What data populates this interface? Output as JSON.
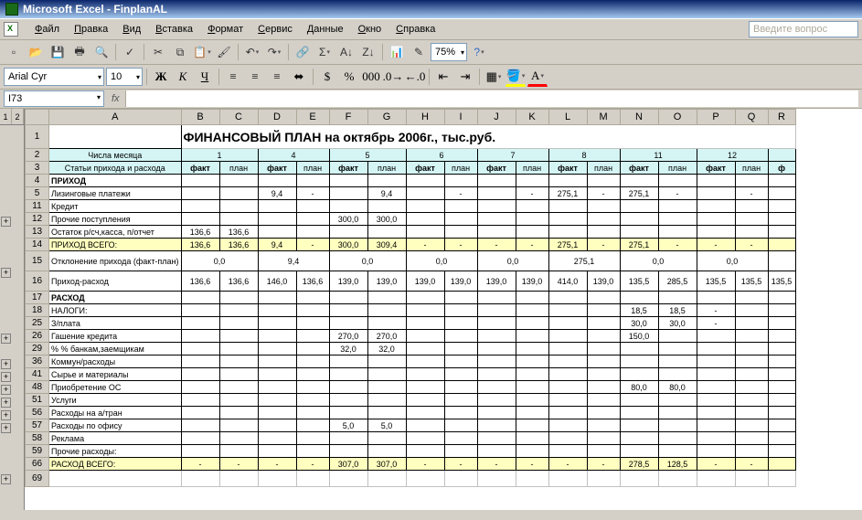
{
  "app_title": "Microsoft Excel - FinplanAL",
  "menus": [
    "Файл",
    "Правка",
    "Вид",
    "Вставка",
    "Формат",
    "Сервис",
    "Данные",
    "Окно",
    "Справка"
  ],
  "help_placeholder": "Введите вопрос",
  "zoom": "75%",
  "font_name": "Arial Cyr",
  "font_size": "10",
  "name_box": "I73",
  "fx_label": "fx",
  "outline_levels": [
    "1",
    "2"
  ],
  "columns": [
    "A",
    "B",
    "C",
    "D",
    "E",
    "F",
    "G",
    "H",
    "I",
    "J",
    "K",
    "L",
    "M",
    "N",
    "O",
    "P",
    "Q",
    "R"
  ],
  "sheet_title": "ФИНАНСОВЫЙ  ПЛАН  на  октябрь  2006г., тыс.руб.",
  "row2_label": "Числа  месяца",
  "row2_vals": {
    "BC": "1",
    "DE": "4",
    "FG": "5",
    "HI": "6",
    "JK": "7",
    "LM": "8",
    "NO": "11",
    "PQ": "12"
  },
  "row3_label": "Статьи прихода и расхода",
  "fact": "факт",
  "plan": "план",
  "rows": {
    "4": {
      "label": "ПРИХОД"
    },
    "5": {
      "label": "Лизинговые платежи",
      "D": "9,4",
      "E": "-",
      "G": "9,4",
      "I": "-",
      "K": "-",
      "L": "275,1",
      "M": "-",
      "N": "275,1",
      "O": "-",
      "Q": "-"
    },
    "11": {
      "label": "Кредит"
    },
    "12": {
      "label": "Прочие поступления",
      "F": "300,0",
      "G": "300,0"
    },
    "13": {
      "label": "Остаток р/сч,касса, п/отчет",
      "B": "136,6",
      "C": "136,6"
    },
    "14": {
      "label": "ПРИХОД ВСЕГО:",
      "B": "136,6",
      "C": "136,6",
      "D": "9,4",
      "E": "-",
      "F": "300,0",
      "G": "309,4",
      "H": "-",
      "I": "-",
      "J": "-",
      "K": "-",
      "L": "275,1",
      "M": "-",
      "N": "275,1",
      "O": "-",
      "P": "-",
      "Q": "-"
    },
    "15": {
      "label": "Отклонение прихода  (факт-план)",
      "BC": "0,0",
      "DE": "9,4",
      "FG": "0,0",
      "HI": "0,0",
      "JK": "0,0",
      "LM": "275,1",
      "NO": "0,0",
      "PQ": "0,0"
    },
    "16": {
      "label": "Приход-расход",
      "B": "136,6",
      "C": "136,6",
      "D": "146,0",
      "E": "136,6",
      "F": "139,0",
      "G": "139,0",
      "H": "139,0",
      "I": "139,0",
      "J": "139,0",
      "K": "139,0",
      "L": "414,0",
      "M": "139,0",
      "N": "135,5",
      "O": "285,5",
      "P": "135,5",
      "Q": "135,5",
      "R": "135,5"
    },
    "17": {
      "label": "РАСХОД"
    },
    "18": {
      "label": "НАЛОГИ:",
      "N": "18,5",
      "O": "18,5",
      "P": "-"
    },
    "25": {
      "label": "З/плата",
      "N": "30,0",
      "O": "30,0",
      "P": "-"
    },
    "26": {
      "label": "Гашение кредита",
      "F": "270,0",
      "G": "270,0",
      "N": "150,0"
    },
    "29": {
      "label": "% % банкам,заемщикам",
      "F": "32,0",
      "G": "32,0"
    },
    "36": {
      "label": "Коммун/расходы"
    },
    "41": {
      "label": "Сырье и материалы"
    },
    "48": {
      "label": "Приобретение ОС",
      "N": "80,0",
      "O": "80,0"
    },
    "51": {
      "label": "Услуги"
    },
    "56": {
      "label": "Расходы на а/тран"
    },
    "57": {
      "label": "Расходы по офису",
      "F": "5,0",
      "G": "5,0"
    },
    "58": {
      "label": "Реклама"
    },
    "59": {
      "label": "Прочие расходы:"
    },
    "66": {
      "label": "РАСХОД ВСЕГО:",
      "B": "-",
      "C": "-",
      "D": "-",
      "E": "-",
      "F": "307,0",
      "G": "307,0",
      "H": "-",
      "I": "-",
      "J": "-",
      "K": "-",
      "L": "-",
      "M": "-",
      "N": "278,5",
      "O": "128,5",
      "P": "-",
      "Q": "-"
    }
  },
  "visible_row_numbers": [
    "1",
    "2",
    "3",
    "4",
    "5",
    "11",
    "12",
    "13",
    "14",
    "15",
    "16",
    "17",
    "18",
    "25",
    "26",
    "29",
    "36",
    "41",
    "48",
    "51",
    "56",
    "57",
    "58",
    "59",
    "66",
    "69"
  ],
  "outline_buttons_at": [
    "11",
    "15",
    "25",
    "29",
    "36",
    "41",
    "48",
    "51",
    "56",
    "66"
  ]
}
